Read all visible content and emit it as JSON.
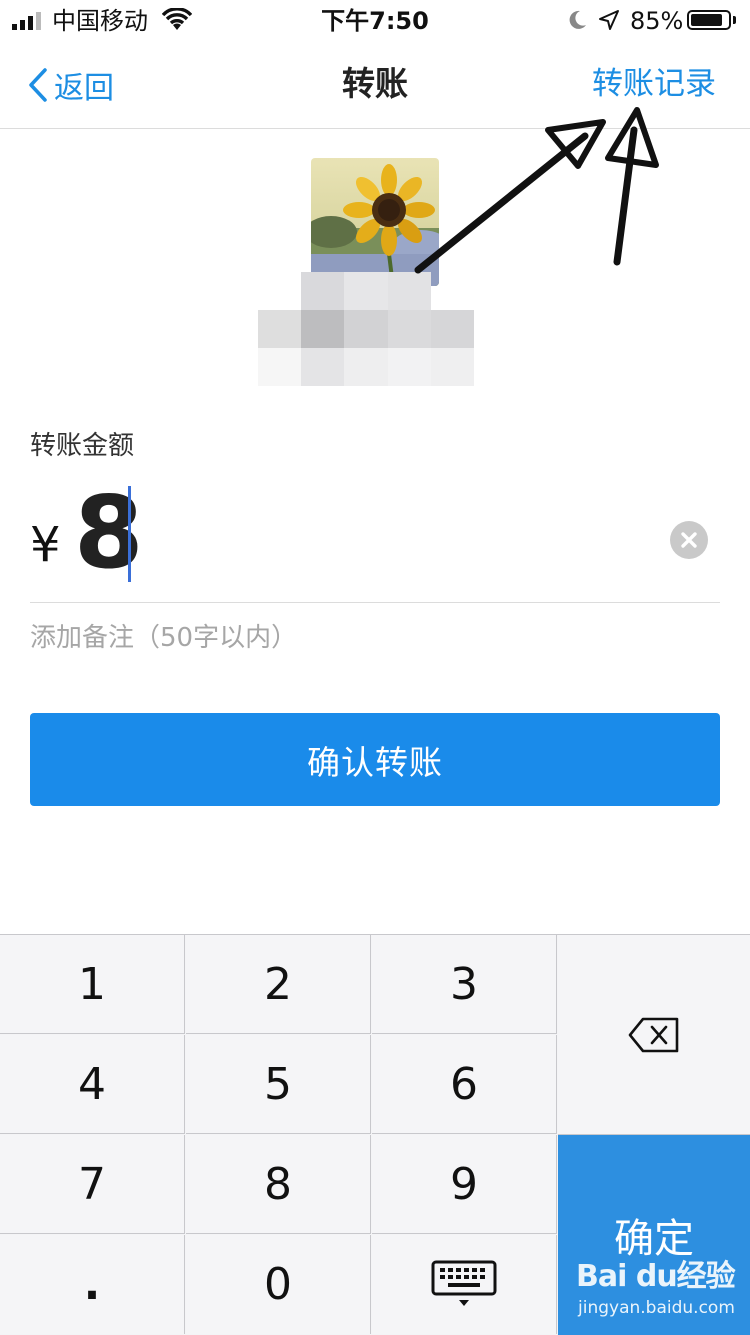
{
  "status_bar": {
    "carrier": "中国移动",
    "time": "下午7:50",
    "battery_percent": "85%",
    "battery_level": 0.85,
    "icons": [
      "signal-icon",
      "wifi-icon",
      "moon-icon",
      "location-arrow-icon",
      "battery-icon"
    ]
  },
  "nav": {
    "back_label": "返回",
    "title": "转账",
    "records_label": "转账记录"
  },
  "recipient": {
    "avatar": "sunflower-avatar",
    "name_mosaic": "pixelated-name"
  },
  "amount": {
    "label": "转账金额",
    "currency": "¥",
    "value": "8"
  },
  "note": {
    "placeholder": "添加备注（50字以内）"
  },
  "confirm_button": "确认转账",
  "keypad": {
    "keys": [
      "1",
      "2",
      "3",
      "4",
      "5",
      "6",
      "7",
      "8",
      "9",
      ".",
      "0"
    ],
    "confirm_key": "确定",
    "delete_icon": "backspace-icon",
    "hide_icon": "keyboard-hide-icon"
  },
  "watermark": {
    "brand": "Bai du经验",
    "url": "jingyan.baidu.com"
  },
  "colors": {
    "accent": "#1a8bea",
    "keypad_confirm": "#2d8fe0",
    "link": "#1d8ee3"
  }
}
